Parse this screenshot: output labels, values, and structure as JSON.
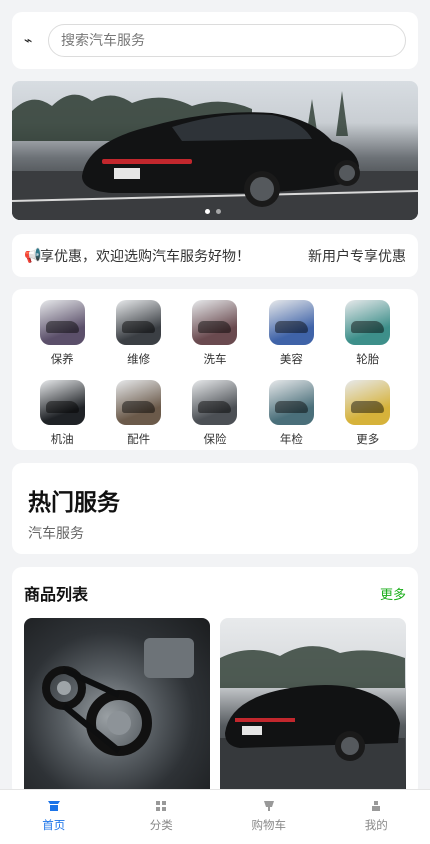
{
  "search": {
    "placeholder": "搜索汽车服务",
    "icon": "flash-icon"
  },
  "banner": {
    "slides": 2,
    "active_slide": 1
  },
  "notice": {
    "icon": "megaphone-icon",
    "text": "享优惠，欢迎选购汽车服务好物！",
    "right_text": "新用户专享优惠"
  },
  "categories": [
    {
      "label": "保养",
      "color": "#5b4f6a"
    },
    {
      "label": "维修",
      "color": "#3b3f44"
    },
    {
      "label": "洗车",
      "color": "#6a4a4f"
    },
    {
      "label": "美容",
      "color": "#3f63a8"
    },
    {
      "label": "轮胎",
      "color": "#3d8f8a"
    },
    {
      "label": "机油",
      "color": "#1f2226"
    },
    {
      "label": "配件",
      "color": "#6b5a4a"
    },
    {
      "label": "保险",
      "color": "#4c5055"
    },
    {
      "label": "年检",
      "color": "#4a6f7a"
    },
    {
      "label": "更多",
      "color": "#d6b23a"
    }
  ],
  "hot": {
    "title": "热门服务",
    "subtitle": "汽车服务"
  },
  "products": {
    "title": "商品列表",
    "more": "更多"
  },
  "tabs": [
    {
      "label": "首页",
      "icon": "home-icon",
      "active": true
    },
    {
      "label": "分类",
      "icon": "category-icon",
      "active": false
    },
    {
      "label": "购物车",
      "icon": "cart-icon",
      "active": false
    },
    {
      "label": "我的",
      "icon": "user-icon",
      "active": false
    }
  ],
  "colors": {
    "accent": "#1a73e8",
    "more_green": "#1aad19",
    "background": "#f2f3f5"
  }
}
